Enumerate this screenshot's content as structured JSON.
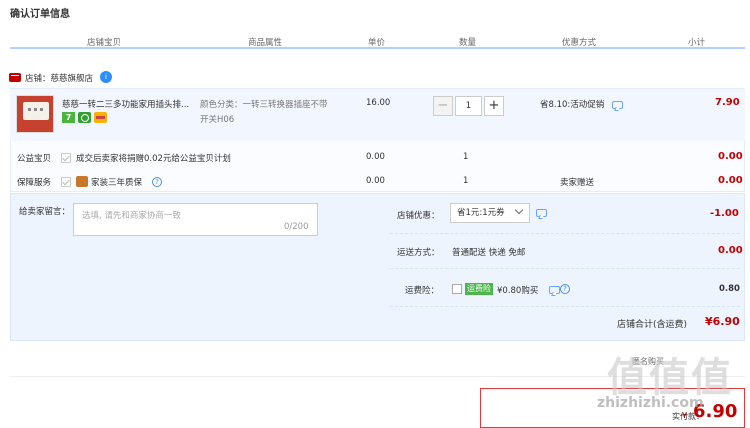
{
  "page_title": "确认订单信息",
  "columns": [
    "店铺宝贝",
    "商品属性",
    "单价",
    "数量",
    "优惠方式",
    "小计"
  ],
  "shop": {
    "label": "店铺：慈慈旗舰店",
    "chat": "i"
  },
  "item": {
    "title": "慈慈一转二三多功能家用插头排...",
    "badge": "7",
    "attr_line1": "颜色分类：一转三转换器插座不带",
    "attr_line2": "开关H06",
    "price": "16.00",
    "qty": "1",
    "qty_minus": "−",
    "qty_plus": "+",
    "promo": "省8.10:活动促销",
    "subtotal": "7.90"
  },
  "charity": {
    "label": "公益宝贝",
    "desc": "成交后卖家将捐赠0.02元给公益宝贝计划",
    "price": "0.00",
    "qty": "1",
    "subtotal": "0.00"
  },
  "guarantee": {
    "label": "保障服务",
    "desc": "家装三年质保",
    "help": "?",
    "price": "0.00",
    "qty": "1",
    "promo": "卖家赠送",
    "subtotal": "0.00"
  },
  "message": {
    "label": "给卖家留言：",
    "placeholder": "选填, 请先和商家协商一致",
    "count": "0/200"
  },
  "shop_discount": {
    "label": "店铺优惠：",
    "value": "省1元:1元券",
    "amount": "-1.00"
  },
  "shipping": {
    "label": "运送方式：",
    "value": "普通配送 快递 免邮",
    "amount": "0.00"
  },
  "insurance": {
    "label": "运费险：",
    "tag": "运费险",
    "value": "¥0.80购买",
    "help": "?",
    "amount": "0.80"
  },
  "shop_total": {
    "label": "店铺合计(含运费)",
    "amount": "¥6.90"
  },
  "pay": {
    "mid_text": "匿名购买",
    "label": "实付款：",
    "currency": "¥",
    "amount": "6.90"
  },
  "watermark": {
    "logo": "值值值",
    "site": "zhizhizhi.com"
  },
  "colors": {
    "accent_red": "#c40000",
    "border_blue": "#b2d1ff",
    "panel_blue": "#eef4fe"
  }
}
